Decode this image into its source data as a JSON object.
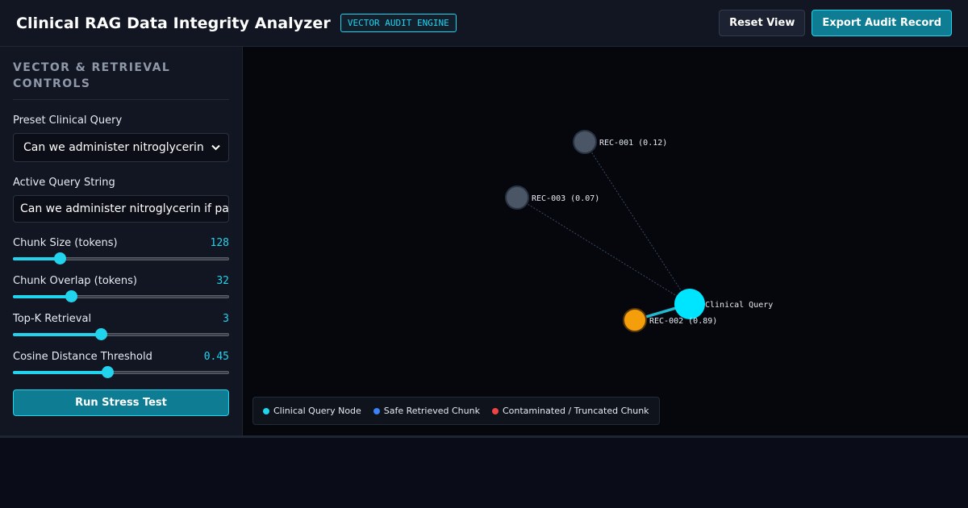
{
  "header": {
    "title": "Clinical RAG Data Integrity Analyzer",
    "badge": "VECTOR AUDIT ENGINE",
    "reset_label": "Reset View",
    "export_label": "Export Audit Record"
  },
  "sidebar": {
    "heading": "VECTOR & RETRIEVAL CONTROLS",
    "preset_label": "Preset Clinical Query",
    "preset_selected": "Can we administer nitroglycerin if pa",
    "query_label": "Active Query String",
    "query_value": "Can we administer nitroglycerin if pa",
    "sliders": [
      {
        "label": "Chunk Size (tokens)",
        "display": "128",
        "level": 0.22
      },
      {
        "label": "Chunk Overlap (tokens)",
        "display": "32",
        "level": 0.27
      },
      {
        "label": "Top-K Retrieval",
        "display": "3",
        "level": 0.41
      },
      {
        "label": "Cosine Distance Threshold",
        "display": "0.45",
        "level": 0.44
      }
    ],
    "run_label": "Run Stress Test"
  },
  "graph": {
    "query_node_label": "Clinical Query",
    "chunks": [
      {
        "label": "REC-001 (0.12)",
        "status": "unretrieved"
      },
      {
        "label": "REC-003 (0.07)",
        "status": "unretrieved"
      },
      {
        "label": "REC-002 (0.89)",
        "status": "retrieved"
      }
    ],
    "colors": {
      "query": "#00e5ff",
      "unretrieved": "#4a5566",
      "retrieved": "#f59e0b",
      "safe": "#3b82f6",
      "contaminated": "#ef4444"
    },
    "legend": [
      {
        "label": "Clinical Query Node",
        "color": "#22d3ee"
      },
      {
        "label": "Safe Retrieved Chunk",
        "color": "#3b82f6"
      },
      {
        "label": "Contaminated / Truncated Chunk",
        "color": "#ef4444"
      }
    ]
  }
}
